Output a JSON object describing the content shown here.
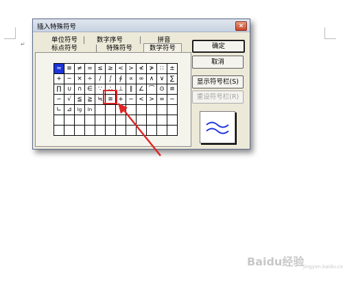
{
  "document": {
    "paragraph_mark": "↵"
  },
  "dialog": {
    "title": "插入特殊符号",
    "close_symbol": "×",
    "tabs": {
      "row1": [
        "单位符号",
        "数字序号",
        "拼音"
      ],
      "row2": [
        "标点符号",
        "特殊符号",
        "数学符号"
      ],
      "active": "数学符号"
    },
    "symbols": [
      "≈",
      "≡",
      "≠",
      "=",
      "≤",
      "≥",
      "<",
      ">",
      "≮",
      "≯",
      "∷",
      "±",
      "+",
      "−",
      "×",
      "÷",
      "/",
      "∫",
      "∮",
      "∝",
      "∞",
      "∧",
      "∨",
      "∑",
      "∏",
      "∪",
      "∩",
      "∈",
      "∵",
      "∴",
      "⊥",
      "∥",
      "∠",
      "⌒",
      "⊙",
      "≌",
      "∽",
      "√",
      "≦",
      "≧",
      "≒",
      "≡",
      "+",
      "−",
      "<",
      ">",
      "=",
      "∼",
      "∟",
      "⊿",
      "lg",
      "ln",
      "",
      "",
      "",
      "",
      "",
      "",
      "",
      "",
      "",
      "",
      "",
      "",
      "",
      "",
      "",
      "",
      "",
      "",
      "",
      "",
      "",
      "",
      "",
      "",
      "",
      "",
      "",
      "",
      "",
      "",
      "",
      ""
    ],
    "selected_index": 0,
    "highlighted_index": 29,
    "buttons": {
      "ok": "确定",
      "cancel": "取消",
      "show_bar": "显示符号栏(S)",
      "reset_bar": "重设符号栏(R)"
    },
    "preview_symbol": "≈"
  },
  "watermark": {
    "text": "Baidu经验",
    "sub": "jingyan.baidu.com"
  },
  "colors": {
    "selection": "#1c35d8",
    "annotation": "#e02424"
  }
}
